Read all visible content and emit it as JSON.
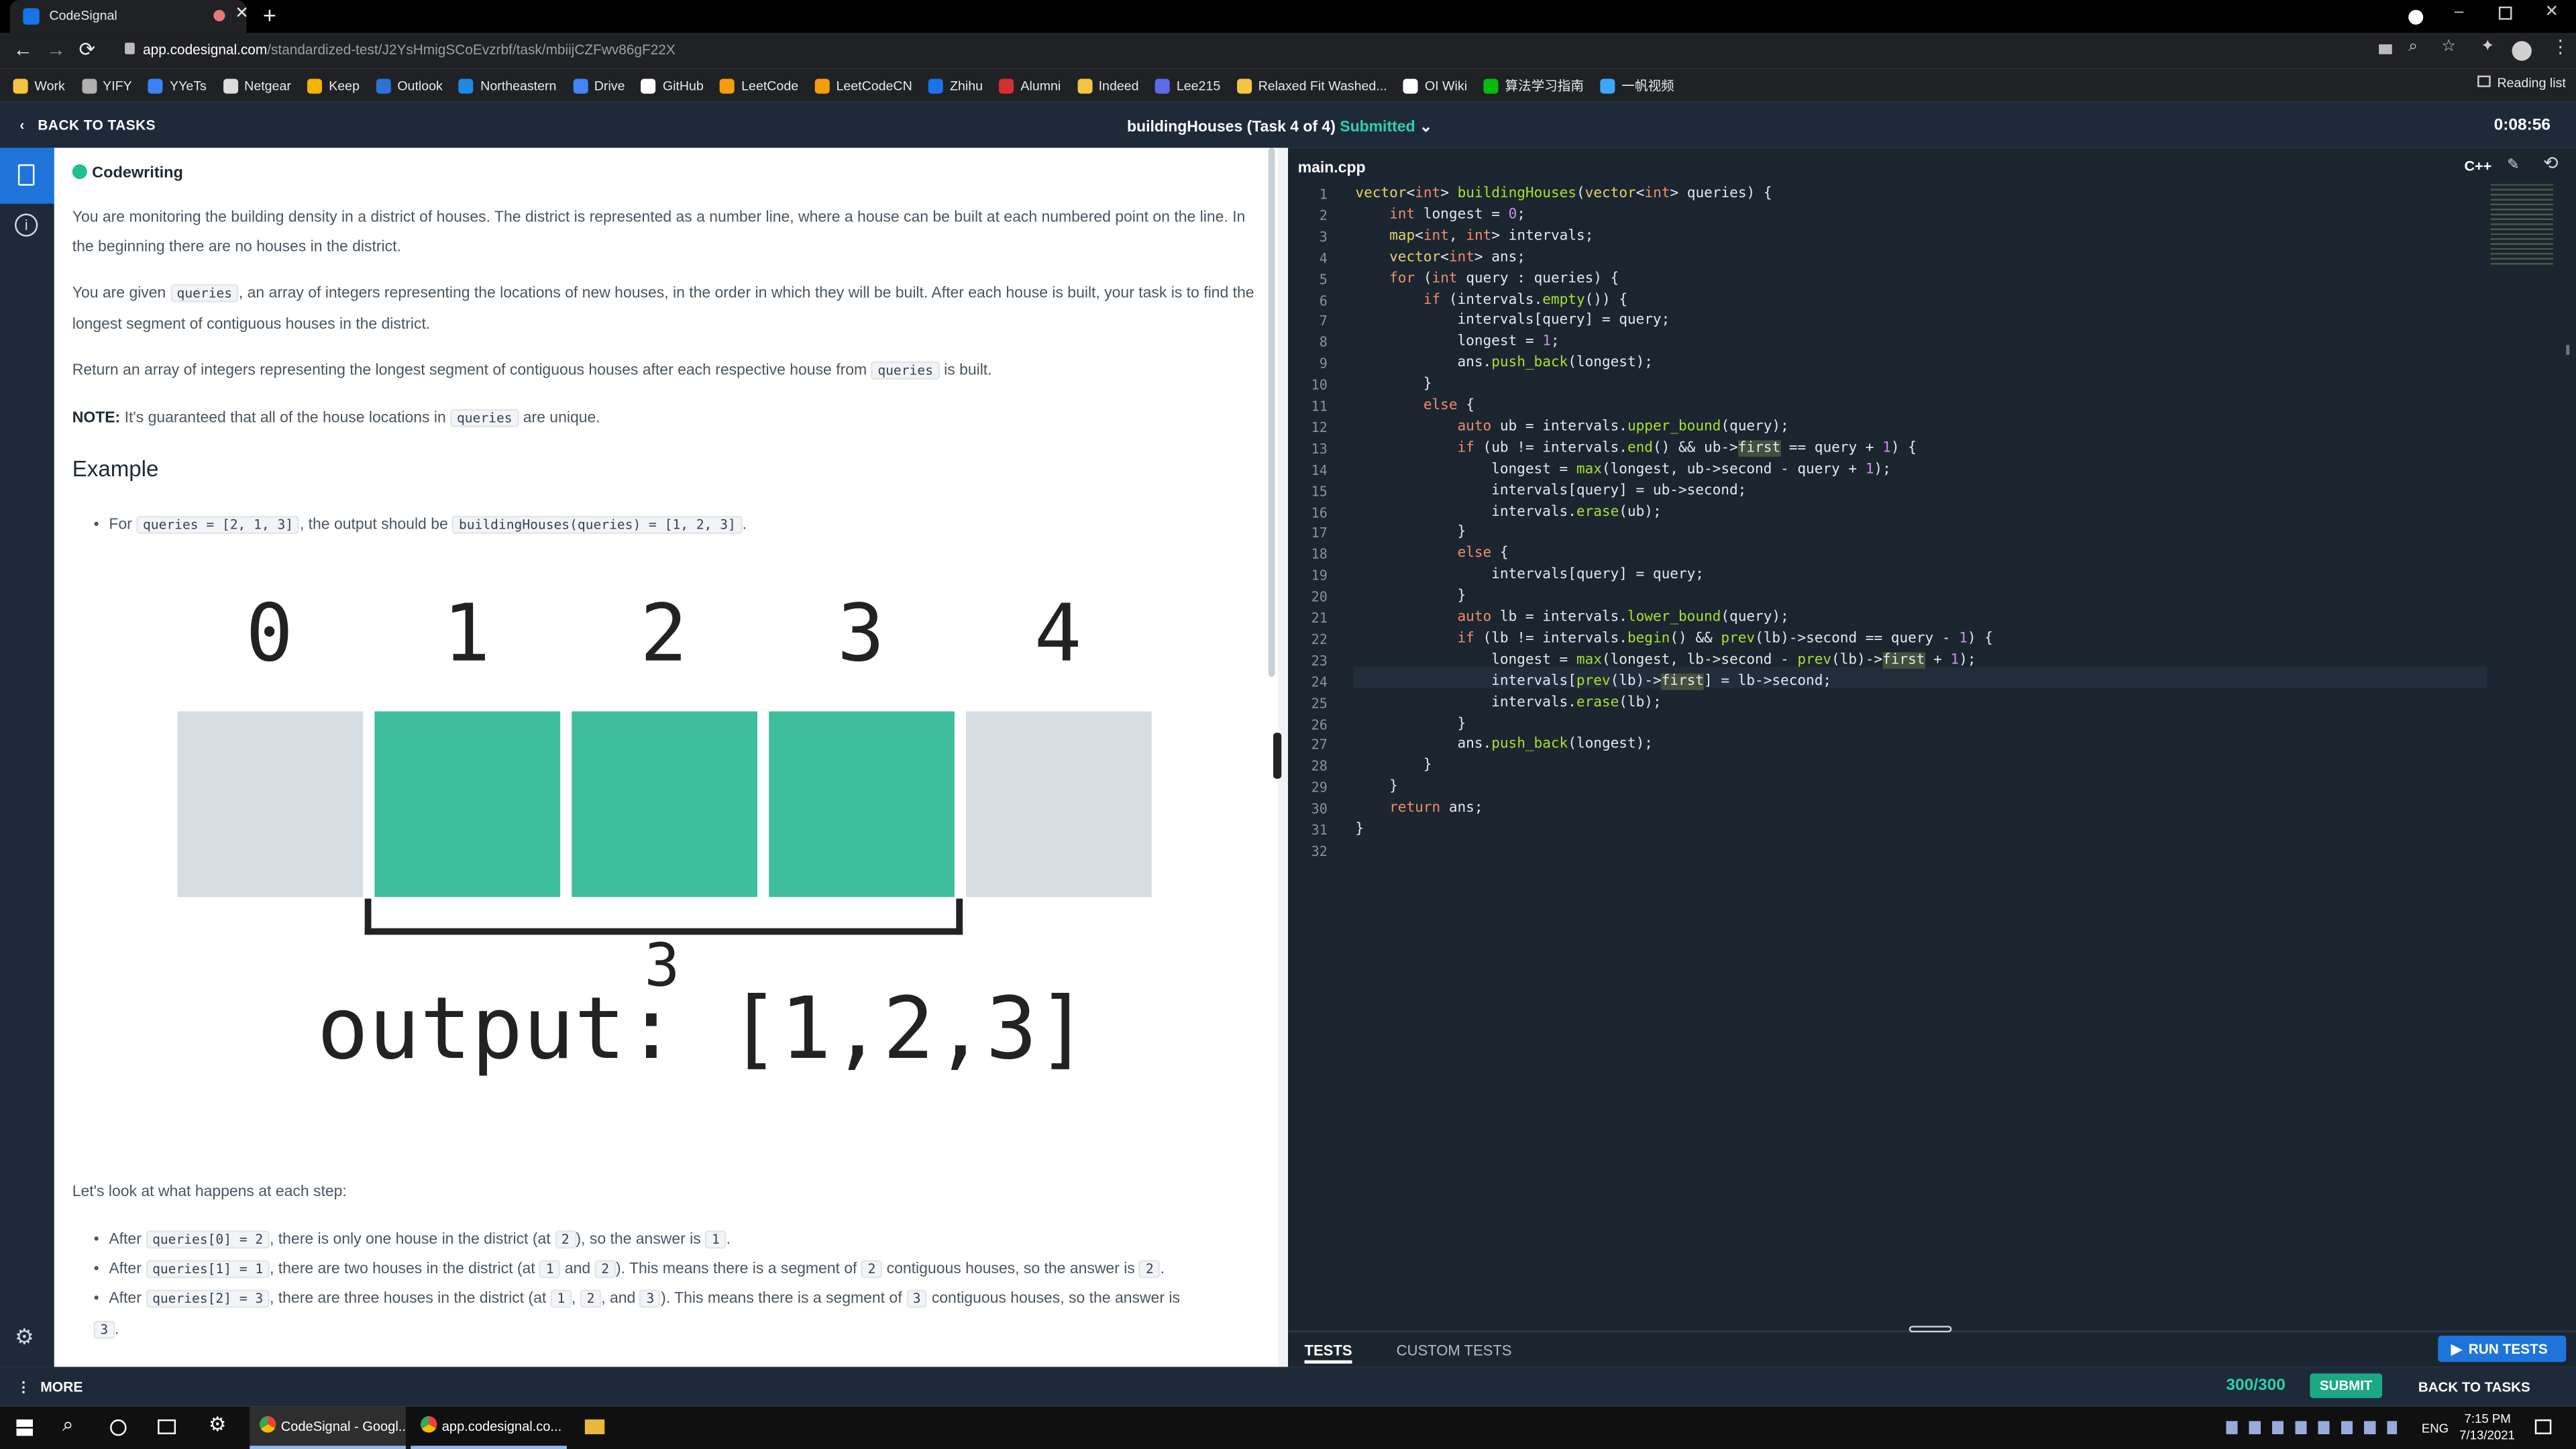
{
  "browser": {
    "tab_title": "CodeSignal",
    "url_host": "app.codesignal.com",
    "url_path": "/standardized-test/J2YsHmigSCoEvzrbf/task/mbiijCZFwv86gF22X",
    "bookmarks": [
      "Work",
      "YIFY",
      "YYeTs",
      "Netgear",
      "Keep",
      "Outlook",
      "Northeastern",
      "Drive",
      "GitHub",
      "LeetCode",
      "LeetCodeCN",
      "Zhihu",
      "Alumni",
      "Indeed",
      "Lee215",
      "Relaxed Fit Washed...",
      "OI Wiki",
      "算法学习指南",
      "一帆视频"
    ],
    "reading_list": "Reading list"
  },
  "header": {
    "back": "BACK TO TASKS",
    "title": "buildingHouses (Task 4 of 4)",
    "status": "Submitted",
    "timer": "0:08:56"
  },
  "problem": {
    "section": "Codewriting",
    "p1": "You are monitoring the building density in a district of houses. The district is represented as a number line, where a house can be built at each numbered point on the line. In the beginning there are no houses in the district.",
    "p2a": "You are given",
    "p2code": "queries",
    "p2b": ", an array of integers representing the locations of new houses, in the order in which they will be built. After each house is built, your task is to find the longest segment of contiguous houses in the district.",
    "p3a": "Return an array of integers representing the longest segment of contiguous houses after each respective house from",
    "p3code": "queries",
    "p3b": "is built.",
    "note_label": "NOTE:",
    "note_a": "It's guaranteed that all of the house locations in",
    "note_code": "queries",
    "note_b": "are unique.",
    "example_title": "Example",
    "ex_for": "For",
    "ex_code1": "queries = [2, 1, 3]",
    "ex_mid": ", the output should be",
    "ex_code2": "buildingHouses(queries) = [1, 2, 3]",
    "ex_end": ".",
    "fig_numbers": [
      "0",
      "1",
      "2",
      "3",
      "4"
    ],
    "fig_segment": "3",
    "fig_output": "output: [1,2,3]",
    "steps_intro": "Let's look at what happens at each step:",
    "s1": {
      "a": "After",
      "c1": "queries[0] = 2",
      "b": ", there is only one house in the district (at",
      "c2": "2",
      "d": "), so the answer is",
      "c3": "1",
      "e": "."
    },
    "s2": {
      "a": "After",
      "c1": "queries[1] = 1",
      "b": ", there are two houses in the district (at",
      "c2": "1",
      "and": "and",
      "c3": "2",
      "d": "). This means there is a segment of",
      "c4": "2",
      "e": "contiguous houses, so the answer is",
      "c5": "2",
      "f": "."
    },
    "s3": {
      "a": "After",
      "c1": "queries[2] = 3",
      "b": ", there are three houses in the district (at",
      "c2": "1",
      "comma": ",",
      "c3": "2",
      "and": ", and",
      "c4": "3",
      "d": "). This means there is a segment of",
      "c5": "3",
      "e": "contiguous houses, so the answer is",
      "c6": "3",
      "f": "."
    }
  },
  "editor": {
    "filename": "main.cpp",
    "language": "C++"
  },
  "tests": {
    "tab1": "TESTS",
    "tab2": "CUSTOM TESTS",
    "run": "RUN TESTS"
  },
  "bottom": {
    "more": "MORE",
    "score": "300/300",
    "submit": "SUBMIT",
    "back": "BACK TO TASKS"
  },
  "taskbar": {
    "app1": "CodeSignal - Googl...",
    "app2": "app.codesignal.co...",
    "lang": "ENG",
    "time": "7:15 PM",
    "date": "7/13/2021"
  }
}
